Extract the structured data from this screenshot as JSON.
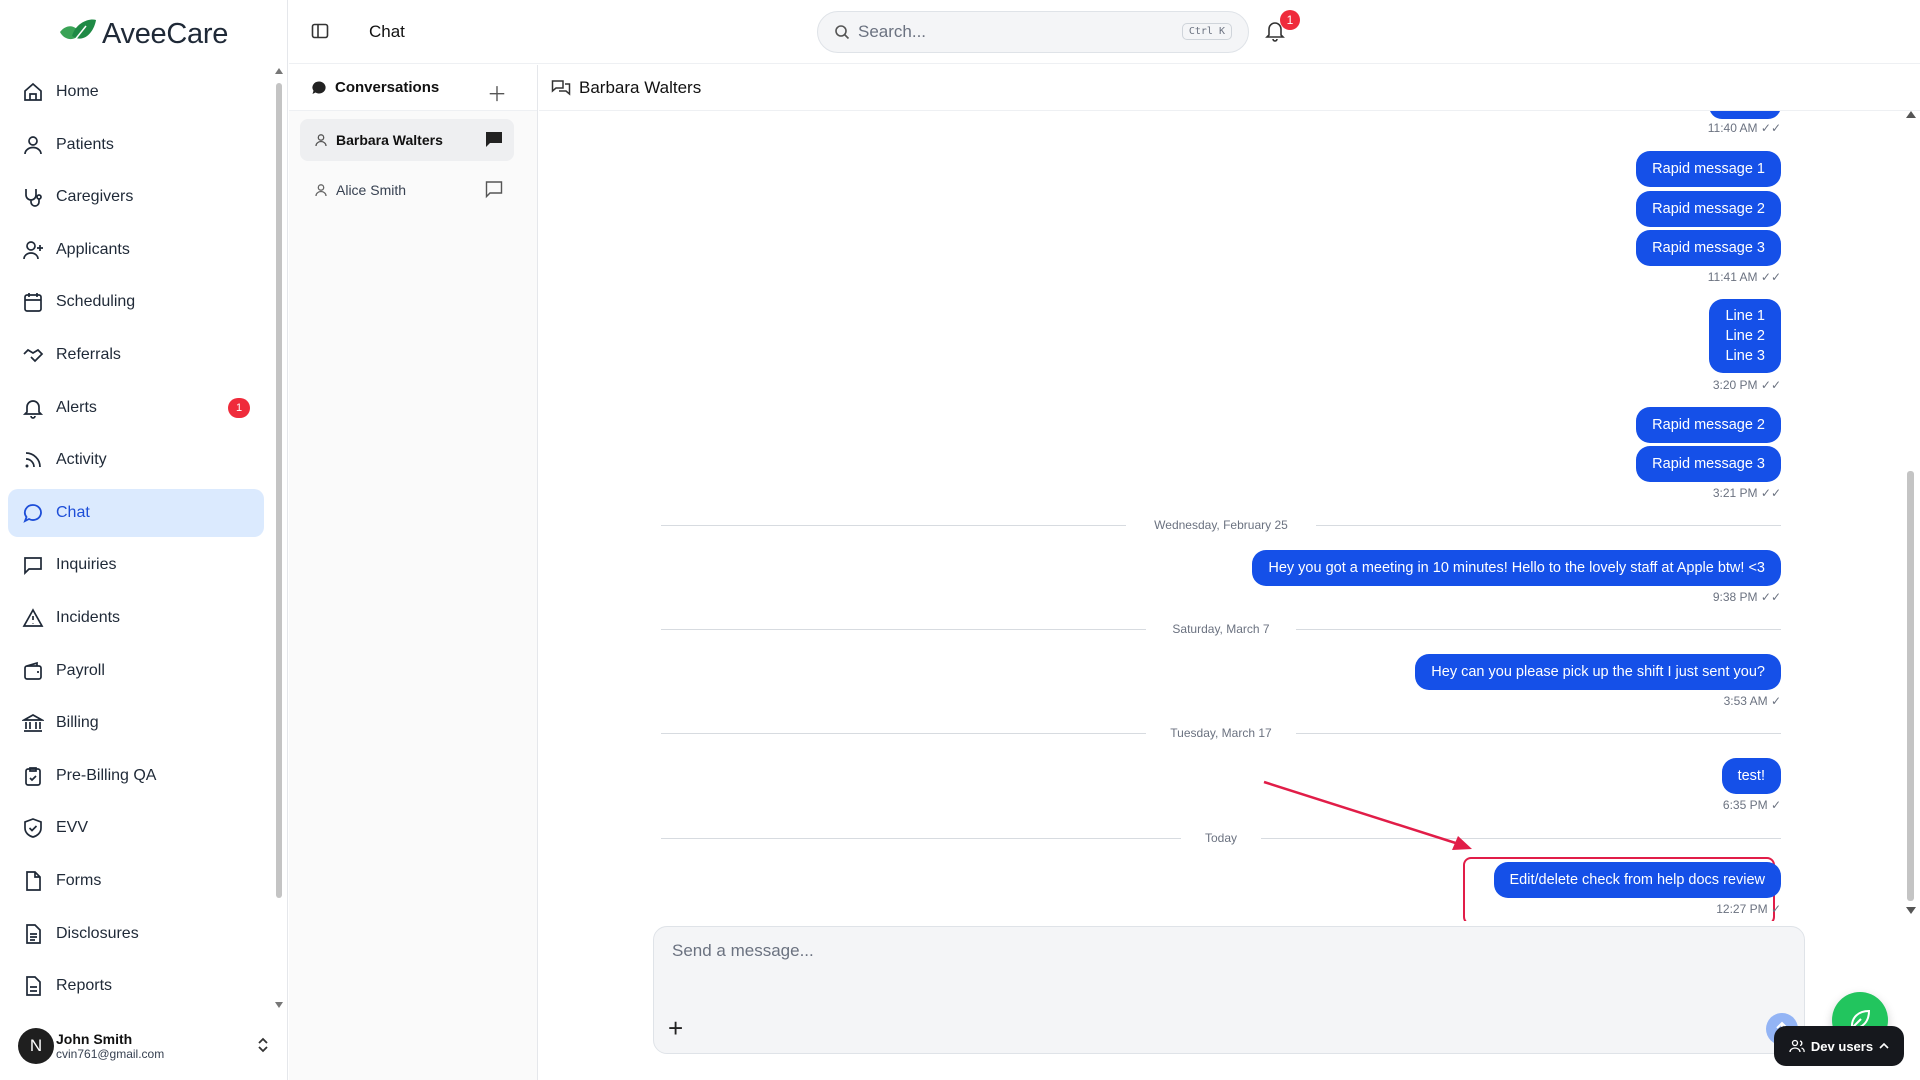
{
  "app": {
    "name": "AveeCare"
  },
  "sidebar": {
    "items": [
      {
        "label": "Home",
        "icon": "home-icon"
      },
      {
        "label": "Patients",
        "icon": "user-icon"
      },
      {
        "label": "Caregivers",
        "icon": "stethoscope-icon"
      },
      {
        "label": "Applicants",
        "icon": "user-plus-icon"
      },
      {
        "label": "Scheduling",
        "icon": "calendar-icon"
      },
      {
        "label": "Referrals",
        "icon": "handshake-icon"
      },
      {
        "label": "Alerts",
        "icon": "bell-icon",
        "badge": "1"
      },
      {
        "label": "Activity",
        "icon": "rss-icon"
      },
      {
        "label": "Chat",
        "icon": "message-circle-icon",
        "active": true
      },
      {
        "label": "Inquiries",
        "icon": "message-square-icon"
      },
      {
        "label": "Incidents",
        "icon": "warning-icon"
      },
      {
        "label": "Payroll",
        "icon": "wallet-icon"
      },
      {
        "label": "Billing",
        "icon": "bank-icon"
      },
      {
        "label": "Pre-Billing QA",
        "icon": "clipboard-check-icon"
      },
      {
        "label": "EVV",
        "icon": "shield-check-icon"
      },
      {
        "label": "Forms",
        "icon": "file-icon"
      },
      {
        "label": "Disclosures",
        "icon": "file-text-icon"
      },
      {
        "label": "Reports",
        "icon": "report-icon"
      }
    ],
    "user": {
      "initial": "N",
      "name": "John Smith",
      "email": "cvin761@gmail.com"
    }
  },
  "topbar": {
    "title": "Chat",
    "search": {
      "placeholder": "Search...",
      "shortcut": "Ctrl K"
    },
    "notification_count": "1"
  },
  "conversations": {
    "title": "Conversations",
    "items": [
      {
        "name": "Barbara Walters",
        "selected": true
      },
      {
        "name": "Alice Smith",
        "selected": false
      }
    ]
  },
  "chat": {
    "contact": "Barbara Walters",
    "messages": [
      {
        "time": "11:40 AM",
        "status": "✓✓"
      },
      {
        "text": "Rapid message 1"
      },
      {
        "text": "Rapid message 2"
      },
      {
        "text": "Rapid message 3",
        "time": "11:41 AM",
        "status": "✓✓"
      },
      {
        "lines": [
          "Line 1",
          "Line 2",
          "Line 3"
        ],
        "time": "3:20 PM",
        "status": "✓✓"
      },
      {
        "text": "Rapid message 2"
      },
      {
        "text": "Rapid message 3",
        "time": "3:21 PM",
        "status": "✓✓"
      },
      {
        "separator": "Wednesday, February 25"
      },
      {
        "text": "Hey you got a meeting in 10 minutes! Hello to the lovely staff at Apple btw! <3",
        "time": "9:38 PM",
        "status": "✓✓"
      },
      {
        "separator": "Saturday, March 7"
      },
      {
        "text": "Hey can you please pick up the shift I just sent you?",
        "time": "3:53 AM",
        "status": "✓"
      },
      {
        "separator": "Tuesday, March 17"
      },
      {
        "text": "test!",
        "time": "6:35 PM",
        "status": "✓"
      },
      {
        "separator": "Today"
      },
      {
        "text": "Edit/delete check from help docs review",
        "time": "12:27 PM",
        "status": "✓",
        "highlighted": true
      }
    ]
  },
  "composer": {
    "placeholder": "Send a message..."
  },
  "dev": {
    "label": "Dev users"
  },
  "colors": {
    "accent": "#1550e8",
    "badge": "#ef2b3b",
    "highlight": "#e11d48",
    "brand_green": "#22c55e"
  }
}
